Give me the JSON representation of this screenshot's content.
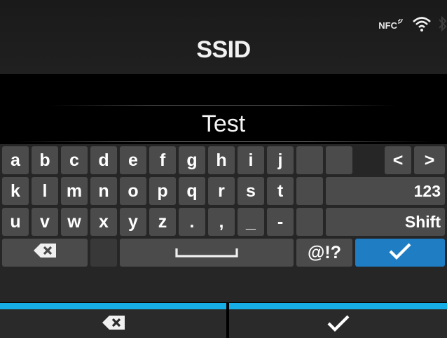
{
  "screen": {
    "title": "SSID",
    "ssid_value": "Test"
  },
  "status": {
    "nfc_label": "NFC",
    "icons": [
      "nfc-icon",
      "wifi-icon",
      "bluetooth-icon"
    ]
  },
  "keyboard": {
    "row1": [
      "a",
      "b",
      "c",
      "d",
      "e",
      "f",
      "g",
      "h",
      "i",
      "j"
    ],
    "nav_left": "<",
    "nav_right": ">",
    "row2": [
      "k",
      "l",
      "m",
      "n",
      "o",
      "p",
      "q",
      "r",
      "s",
      "t"
    ],
    "numeric_label": "123",
    "row3": [
      "u",
      "v",
      "w",
      "x",
      "y",
      "z",
      ".",
      ",",
      "_",
      "-"
    ],
    "shift_label": "Shift",
    "symbols_label": "@!?",
    "icons": {
      "backspace": "backspace-icon",
      "space": "space-bar-icon",
      "confirm": "checkmark-icon"
    }
  },
  "footer": {
    "icons": [
      "backspace-icon",
      "checkmark-icon"
    ]
  },
  "colors": {
    "accent_blue": "#1f7ec3",
    "bar_cyan": "#17aee8",
    "key_gray": "#4b4b4b",
    "key_dark": "#383838",
    "background": "#000000"
  }
}
